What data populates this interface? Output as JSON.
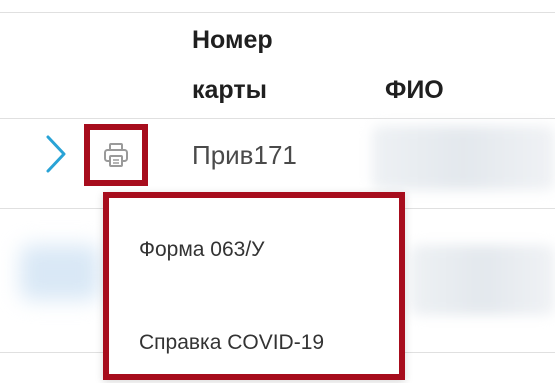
{
  "table": {
    "header": {
      "card_number_line1": "Номер",
      "card_number_line2": "карты",
      "fio": "ФИО"
    },
    "row": {
      "card_number": "Прив171"
    }
  },
  "print_menu": {
    "items": [
      {
        "label": "Форма 063/У"
      },
      {
        "label": "Справка COVID-19"
      }
    ]
  },
  "icons": {
    "expand": "chevron-right-icon",
    "print": "printer-icon"
  },
  "colors": {
    "highlight_border": "#a70d1d",
    "chevron": "#29a3d6",
    "divider": "#e0e0e0",
    "icon_gray": "#9a9a9a"
  }
}
